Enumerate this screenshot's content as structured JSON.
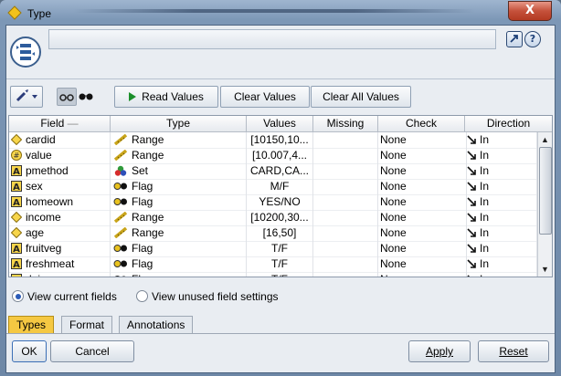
{
  "window": {
    "title": "Type",
    "close_glyph": "X"
  },
  "header": {
    "name_value": "",
    "launch_icon": "launch-icon",
    "help_label": "?"
  },
  "toolbar": {
    "read_values": "Read Values",
    "clear_values": "Clear Values",
    "clear_all_values": "Clear All Values"
  },
  "table": {
    "columns": [
      "Field",
      "Type",
      "Values",
      "Missing",
      "Check",
      "Direction"
    ],
    "sort_indicator": "—",
    "rows": [
      {
        "field": "cardid",
        "field_icon": "continuous",
        "type": "Range",
        "type_icon": "ruler",
        "values": "[10150,10...",
        "missing": "",
        "check": "None",
        "direction": "In"
      },
      {
        "field": "value",
        "field_icon": "real",
        "type": "Range",
        "type_icon": "ruler",
        "values": "[10.007,4...",
        "missing": "",
        "check": "None",
        "direction": "In"
      },
      {
        "field": "pmethod",
        "field_icon": "string",
        "type": "Set",
        "type_icon": "set",
        "values": "CARD,CA...",
        "missing": "",
        "check": "None",
        "direction": "In"
      },
      {
        "field": "sex",
        "field_icon": "string",
        "type": "Flag",
        "type_icon": "flag",
        "values": "M/F",
        "missing": "",
        "check": "None",
        "direction": "In"
      },
      {
        "field": "homeown",
        "field_icon": "string",
        "type": "Flag",
        "type_icon": "flag",
        "values": "YES/NO",
        "missing": "",
        "check": "None",
        "direction": "In"
      },
      {
        "field": "income",
        "field_icon": "continuous",
        "type": "Range",
        "type_icon": "ruler",
        "values": "[10200,30...",
        "missing": "",
        "check": "None",
        "direction": "In"
      },
      {
        "field": "age",
        "field_icon": "continuous",
        "type": "Range",
        "type_icon": "ruler",
        "values": "[16,50]",
        "missing": "",
        "check": "None",
        "direction": "In"
      },
      {
        "field": "fruitveg",
        "field_icon": "string",
        "type": "Flag",
        "type_icon": "flag",
        "values": "T/F",
        "missing": "",
        "check": "None",
        "direction": "In"
      },
      {
        "field": "freshmeat",
        "field_icon": "string",
        "type": "Flag",
        "type_icon": "flag",
        "values": "T/F",
        "missing": "",
        "check": "None",
        "direction": "In"
      },
      {
        "field": "dairy",
        "field_icon": "string",
        "type": "Flag",
        "type_icon": "flag",
        "values": "T/F",
        "missing": "",
        "check": "None",
        "direction": "In"
      }
    ]
  },
  "view_options": {
    "current": "View current fields",
    "unused": "View unused field settings",
    "selected": "current"
  },
  "tabs": [
    "Types",
    "Format",
    "Annotations"
  ],
  "active_tab": "Types",
  "buttons": {
    "ok": "OK",
    "cancel": "Cancel",
    "apply": "Apply",
    "reset": "Reset"
  },
  "colors": {
    "active_tab": "#f5c842",
    "window_frame": "#7c97b6",
    "close_button": "#c5513b"
  }
}
